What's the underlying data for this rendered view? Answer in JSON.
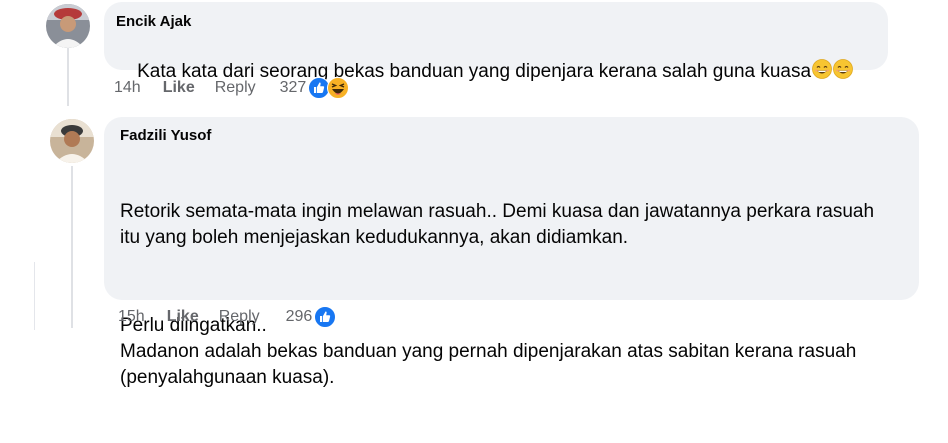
{
  "comments": [
    {
      "author": "Encik Ajak",
      "paragraphs": [
        "Kata kata dari seorang bekas banduan yang dipenjara kerana salah guna kuasa"
      ],
      "trailing_emojis": [
        "grinning-smiling-eyes",
        "grinning-smiling-eyes"
      ],
      "time": "14h",
      "like_label": "Like",
      "reply_label": "Reply",
      "reaction_count": "327",
      "reactions": [
        "like",
        "haha"
      ]
    },
    {
      "author": "Fadzili Yusof",
      "paragraphs": [
        "Retorik semata-mata ingin melawan rasuah.. Demi kuasa dan jawatannya perkara rasuah\nitu yang boleh menjejaskan kedudukannya, akan didiamkan.",
        "Perlu diingatkan..\nMadanon adalah bekas banduan yang pernah dipenjarakan atas sabitan kerana rasuah\n(penyalahgunaan kuasa)."
      ],
      "time": "15h",
      "like_label": "Like",
      "reply_label": "Reply",
      "reaction_count": "296",
      "reactions": [
        "like"
      ]
    }
  ],
  "colors": {
    "bubble": "#f0f2f5",
    "meta_text": "#65676b",
    "like_blue": "#1877f2",
    "haha_yellow": "#f7b125"
  }
}
